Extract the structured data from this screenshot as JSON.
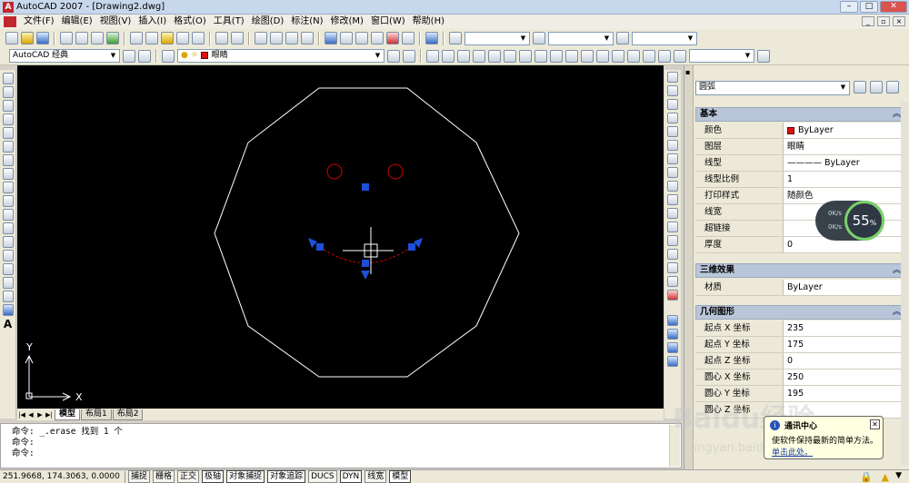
{
  "window": {
    "title": "AutoCAD 2007 - [Drawing2.dwg]",
    "min": "–",
    "max": "□",
    "close": "✕",
    "doc_min": "_",
    "doc_max": "▫",
    "doc_close": "×"
  },
  "menu": [
    "文件(F)",
    "编辑(E)",
    "视图(V)",
    "插入(I)",
    "格式(O)",
    "工具(T)",
    "绘图(D)",
    "标注(N)",
    "修改(M)",
    "窗口(W)",
    "帮助(H)"
  ],
  "toolbar2": {
    "workspace": "AutoCAD 经典",
    "layer": "眼睛"
  },
  "tabs": {
    "model": "模型",
    "layout1": "布局1",
    "layout2": "布局2"
  },
  "ucs": {
    "x": "X",
    "y": "Y"
  },
  "command": {
    "lines": [
      "命令: _.erase 找到 1 个",
      "命令:",
      "命令:"
    ]
  },
  "status": {
    "coords": "251.9668, 174.3063, 0.0000",
    "buttons": [
      "捕捉",
      "栅格",
      "正交",
      "极轴",
      "对象捕捉",
      "对象追踪",
      "DUCS",
      "DYN",
      "线宽",
      "模型"
    ]
  },
  "properties": {
    "object_type": "圆弧",
    "sections": {
      "basic": {
        "title": "基本",
        "rows": [
          {
            "k": "颜色",
            "v": "ByLayer",
            "swatch": "#dd1111"
          },
          {
            "k": "图层",
            "v": "眼睛"
          },
          {
            "k": "线型",
            "v": "———— ByLayer"
          },
          {
            "k": "线型比例",
            "v": "1"
          },
          {
            "k": "打印样式",
            "v": "随颜色"
          },
          {
            "k": "线宽",
            "v": ""
          },
          {
            "k": "超链接",
            "v": ""
          },
          {
            "k": "厚度",
            "v": "0"
          }
        ]
      },
      "3d": {
        "title": "三维效果",
        "rows": [
          {
            "k": "材质",
            "v": "ByLayer"
          }
        ]
      },
      "geometry": {
        "title": "几何图形",
        "rows": [
          {
            "k": "起点 X 坐标",
            "v": "235"
          },
          {
            "k": "起点 Y 坐标",
            "v": "175"
          },
          {
            "k": "起点 Z 坐标",
            "v": "0"
          },
          {
            "k": "圆心 X 坐标",
            "v": "250"
          },
          {
            "k": "圆心 Y 坐标",
            "v": "195"
          },
          {
            "k": "圆心 Z 坐标",
            "v": ""
          }
        ]
      }
    }
  },
  "gauge": {
    "percent": "55",
    "unit": "%",
    "up": "0K/s",
    "down": "0K/s"
  },
  "balloon": {
    "title": "通讯中心",
    "body": "使软件保持最新的简单方法。",
    "link": "单击此处。"
  },
  "watermark": {
    "brand": "Baidu经验",
    "url": "jingyan.baidu.com"
  },
  "colors": {
    "canvas": "#000000",
    "outline": "#ffffff",
    "eyes": "#cc0000",
    "grip": "#1e4fd6"
  }
}
